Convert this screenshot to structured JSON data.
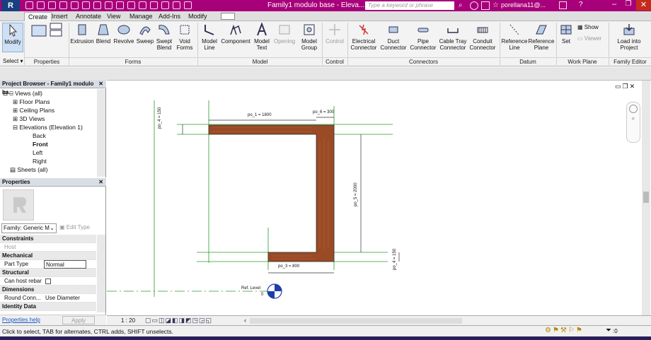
{
  "app": {
    "logo": "R",
    "title": "Family1 modulo base - Eleva...",
    "search_placeholder": "Type a keyword or phrase",
    "user": "porellana11@..."
  },
  "tabs": [
    "Create",
    "Insert",
    "Annotate",
    "View",
    "Manage",
    "Add-Ins",
    "Modify"
  ],
  "ribbon": {
    "modify": "Modify",
    "select": "Select",
    "select_arrow": "▾",
    "properties": "Properties",
    "forms": [
      "Extrusion",
      "Blend",
      "Revolve",
      "Sweep",
      "Swept Blend",
      "Void Forms"
    ],
    "model": [
      "Model Line",
      "Component",
      "Model Text",
      "Opening",
      "Model Group"
    ],
    "control": "Control",
    "connectors": [
      "Electrical Connector",
      "Duct Connector",
      "Pipe Connector",
      "Cable Tray Connector",
      "Conduit Connector"
    ],
    "datum": [
      "Reference Line",
      "Reference Plane"
    ],
    "workplane": {
      "set": "Set",
      "show": "Show",
      "viewer": "Viewer"
    },
    "familyeditor": "Load into Project",
    "panels": {
      "forms": "Forms",
      "model": "Model",
      "control": "Control",
      "connectors": "Connectors",
      "datum": "Datum",
      "workplane": "Work Plane",
      "familyeditor": "Family Editor"
    }
  },
  "project_browser": {
    "title": "Project Browser - Family1 modulo ba...",
    "items": [
      "Views (all)",
      "Floor Plans",
      "Ceiling Plans",
      "3D Views",
      "Elevations (Elevation 1)",
      "Back",
      "Front",
      "Left",
      "Right",
      "Sheets (all)"
    ]
  },
  "properties": {
    "title": "Properties",
    "family": "Family: Generic M",
    "edit_type": "Edit Type",
    "rows": [
      {
        "type": "group",
        "label": "Constraints"
      },
      {
        "type": "prop",
        "label": "Host",
        "value": ""
      },
      {
        "type": "group",
        "label": "Mechanical"
      },
      {
        "type": "prop",
        "label": "Part Type",
        "value": "Normal"
      },
      {
        "type": "group",
        "label": "Structural"
      },
      {
        "type": "prop",
        "label": "Can host rebar",
        "value": ""
      },
      {
        "type": "group",
        "label": "Dimensions"
      },
      {
        "type": "prop",
        "label": "Round Conn...",
        "value": "Use Diameter"
      },
      {
        "type": "group",
        "label": "Identity Data"
      }
    ],
    "help": "Properties help",
    "apply": "Apply"
  },
  "drawing": {
    "dims": [
      "po_1 = 1800",
      "po_6 = 300",
      "po_4 = 150",
      "po_5 = 2000",
      "po_3 = 800",
      "po_4 = 150"
    ],
    "level": "Ref. Level",
    "level_value": "0"
  },
  "viewbar": {
    "scale": "1 : 20"
  },
  "status": "Click to select, TAB for alternates, CTRL adds, SHIFT unselects.",
  "status_right": ":0",
  "colors": {
    "titlebar": "#a7007a",
    "wood": "#9a4a25",
    "level_blue": "#1f3fa8",
    "refplane_green": "#2a9a2a"
  }
}
